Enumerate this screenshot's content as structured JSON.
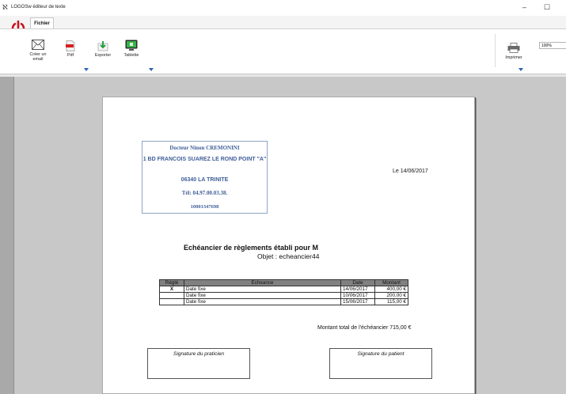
{
  "window": {
    "title": "LOGOSw éditeur de texte",
    "logo_glyph": "ℵ",
    "minimize_glyph": "–",
    "maximize_glyph": "☐"
  },
  "menu": {
    "file_tab": "Fichier"
  },
  "toolbar": {
    "create_email": "Créer un email",
    "pdf": "Pdf",
    "export": "Exporter",
    "tablet": "Tablette",
    "print": "Imprimer",
    "zoom_value": "100%"
  },
  "document": {
    "doctor_name": "Docteur Ninon CREMONINI",
    "address": "1 BD FRANCOIS SUAREZ    LE ROND POINT \"A\"",
    "city": "06340 LA TRINITE",
    "phone": "Tél: 04.97.00.03.38.",
    "id_number": "10001347698",
    "date_line": "Le 14/06/2017",
    "heading": "Echéancier de règlements établi pour M",
    "subject": "Objet : echeancier44",
    "table": {
      "headers": [
        "Réglé",
        "Echeance",
        "Date",
        "Montant"
      ],
      "rows": [
        [
          "X",
          "Date fixe",
          "14/06/2017",
          "400,00 €"
        ],
        [
          "",
          "Date fixe",
          "10/06/2017",
          "200,00 €"
        ],
        [
          "",
          "Date fixe",
          "15/06/2017",
          "115,00 €"
        ]
      ]
    },
    "total": "Montant total de l'échéancier 715,00 €",
    "signature_practitioner": "Signature du praticien",
    "signature_patient": "Signature du patient"
  },
  "colors": {
    "power_red": "#c8141e",
    "header_blue": "#3f5f98",
    "dropdown_blue": "#2c62b8",
    "table_header_gray": "#808080"
  }
}
